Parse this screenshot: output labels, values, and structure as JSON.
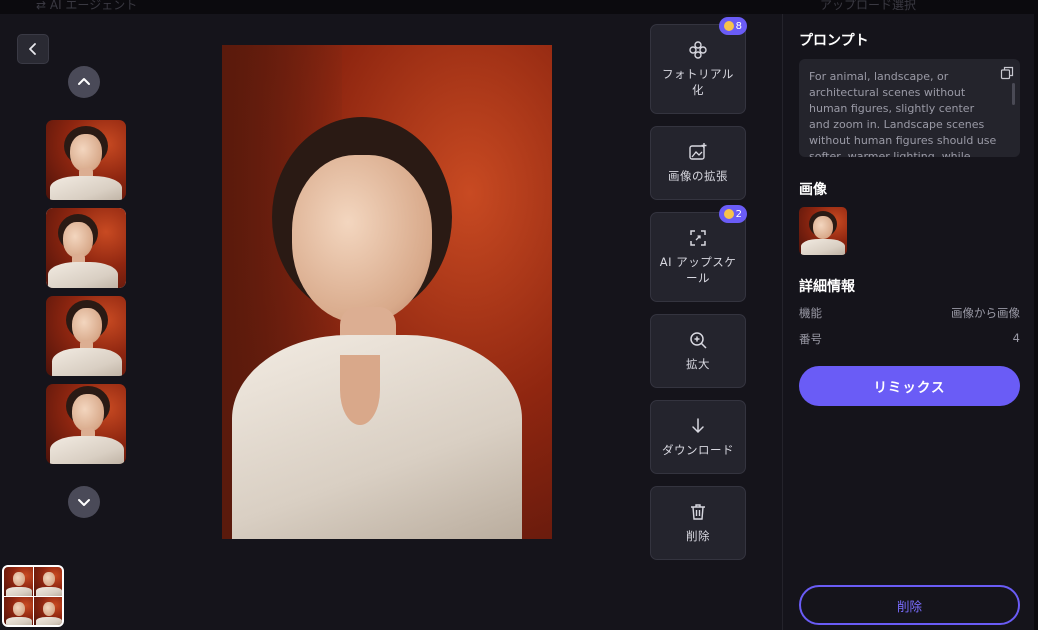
{
  "top_strip": {
    "ghost_left": "⇄ AI エージェント",
    "ghost_right": "アップロード選択"
  },
  "tools": [
    {
      "id": "photoreal",
      "label": "フォトリアル化",
      "icon": "sparkle-cross-icon",
      "badge": "8"
    },
    {
      "id": "expand",
      "label": "画像の拡張",
      "icon": "image-expand-icon",
      "badge": null
    },
    {
      "id": "upscale",
      "label": "AI アップスケール",
      "icon": "upscale-frame-icon",
      "badge": "2"
    },
    {
      "id": "zoom",
      "label": "拡大",
      "icon": "zoom-in-icon",
      "badge": null
    },
    {
      "id": "download",
      "label": "ダウンロード",
      "icon": "download-arrow-icon",
      "badge": null
    },
    {
      "id": "delete",
      "label": "削除",
      "icon": "trash-icon",
      "badge": null
    }
  ],
  "panel": {
    "prompt_title": "プロンプト",
    "prompt_text": "For animal, landscape, or architectural scenes without human figures, slightly center and zoom in. Landscape scenes without human figures should use softer, warmer lighting, while night scenes",
    "image_title": "画像",
    "details_title": "詳細情報",
    "details": [
      {
        "label": "機能",
        "value": "画像から画像"
      },
      {
        "label": "番号",
        "value": "4"
      }
    ],
    "remix_label": "リミックス",
    "delete_label": "削除"
  },
  "colors": {
    "accent": "#6a5cf6",
    "badge_coin": "#f5c34a",
    "background": "#15141b",
    "button_bg": "#24242d"
  }
}
